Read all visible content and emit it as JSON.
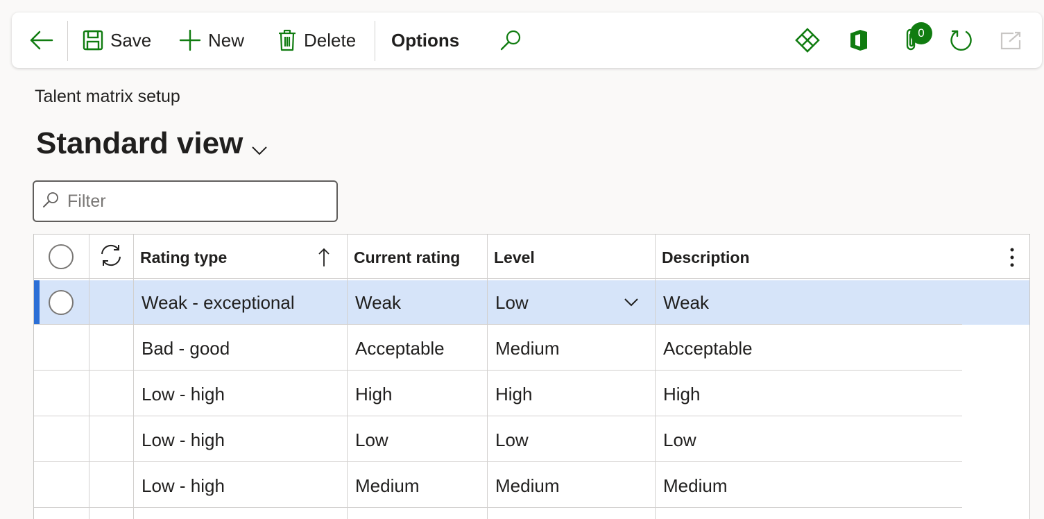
{
  "toolbar": {
    "save_label": "Save",
    "new_label": "New",
    "delete_label": "Delete",
    "options_label": "Options",
    "attachments_count": "0",
    "accent_color": "#107c10"
  },
  "page": {
    "breadcrumb": "Talent matrix setup",
    "view_name": "Standard view"
  },
  "filter": {
    "placeholder": "Filter",
    "value": ""
  },
  "grid": {
    "columns": [
      "Rating type",
      "Current rating",
      "Level",
      "Description"
    ],
    "sort_column": "Rating type",
    "sort_direction": "ascending",
    "rows": [
      {
        "rating_type": "Weak - exceptional",
        "current_rating": "Weak",
        "level": "Low",
        "description": "Weak",
        "selected": true
      },
      {
        "rating_type": "Bad - good",
        "current_rating": "Acceptable",
        "level": "Medium",
        "description": "Acceptable",
        "selected": false
      },
      {
        "rating_type": "Low - high",
        "current_rating": "High",
        "level": "High",
        "description": "High",
        "selected": false
      },
      {
        "rating_type": "Low - high",
        "current_rating": "Low",
        "level": "Low",
        "description": "Low",
        "selected": false
      },
      {
        "rating_type": "Low - high",
        "current_rating": "Medium",
        "level": "Medium",
        "description": "Medium",
        "selected": false
      }
    ]
  }
}
